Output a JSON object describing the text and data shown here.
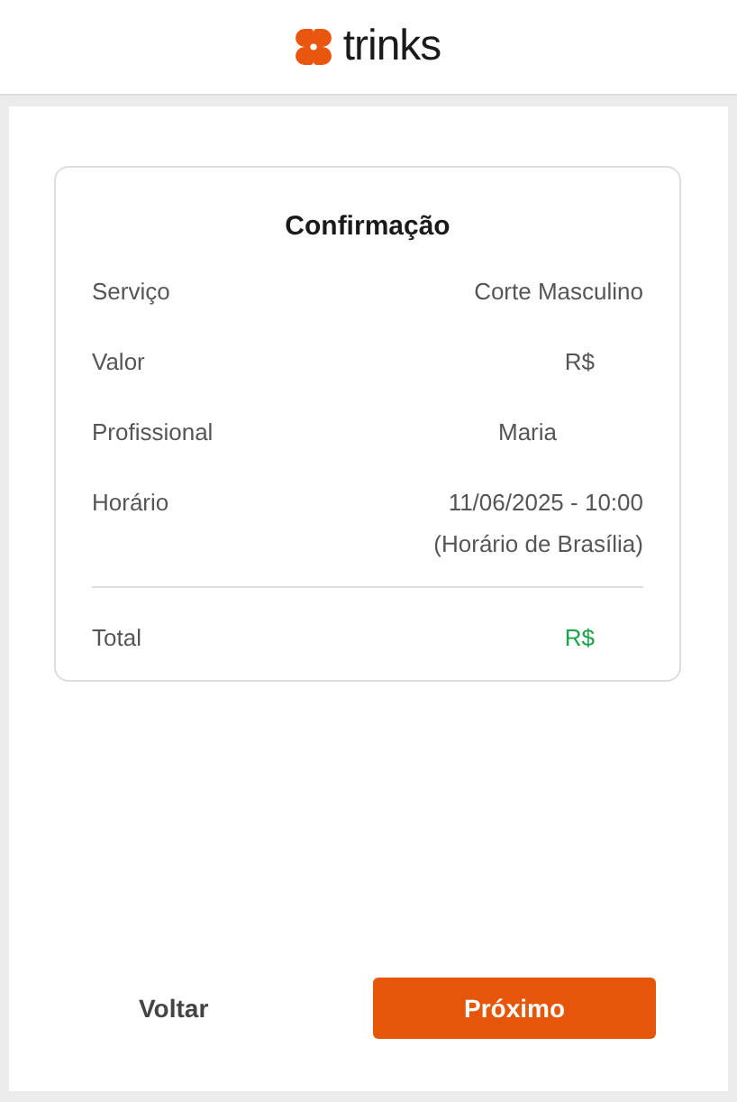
{
  "header": {
    "brand": "trinks"
  },
  "confirmation": {
    "title": "Confirmação",
    "rows": [
      {
        "label": "Serviço",
        "value": "Corte Masculino"
      },
      {
        "label": "Valor",
        "value": "R$"
      },
      {
        "label": "Profissional",
        "value": "Maria"
      },
      {
        "label": "Horário",
        "value": "11/06/2025 - 10:00",
        "note": "(Horário de Brasília)"
      }
    ],
    "total": {
      "label": "Total",
      "value": "R$"
    }
  },
  "buttons": [
    {
      "label": "Voltar",
      "kind": "secondary"
    },
    {
      "label": "Próximo",
      "kind": "primary"
    }
  ]
}
